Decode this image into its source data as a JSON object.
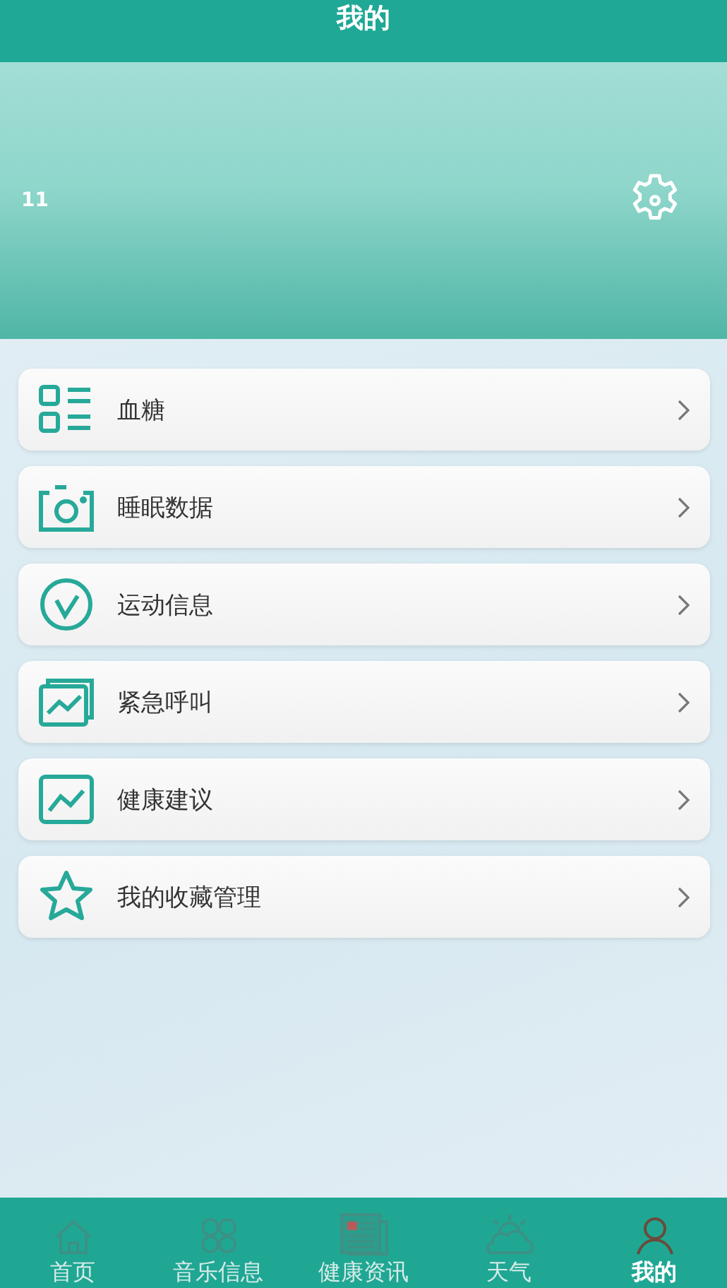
{
  "header": {
    "title": "我的"
  },
  "profile": {
    "username": "11"
  },
  "menu": [
    {
      "label": "血糖"
    },
    {
      "label": "睡眠数据"
    },
    {
      "label": "运动信息"
    },
    {
      "label": "紧急呼叫"
    },
    {
      "label": "健康建议"
    },
    {
      "label": "我的收藏管理"
    }
  ],
  "tab_bar": [
    {
      "label": "首页",
      "selected": false
    },
    {
      "label": "音乐信息",
      "selected": false
    },
    {
      "label": "健康资讯",
      "selected": false
    },
    {
      "label": "天气",
      "selected": false
    },
    {
      "label": "我的",
      "selected": true
    }
  ]
}
